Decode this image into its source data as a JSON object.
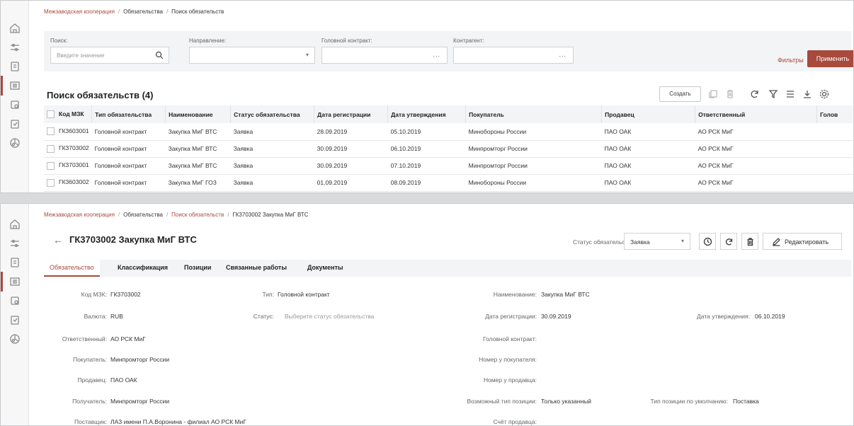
{
  "breadcrumbs1": [
    "Межзаводская кооперация",
    "Обязательства",
    "Поиск обязательств"
  ],
  "breadcrumbs2": [
    "Межзаводская кооперация",
    "Обязательства",
    "Поиск обязательств",
    "ГК3703002 Закупка МиГ ВТС"
  ],
  "filters": {
    "search_label": "Поиск:",
    "search_placeholder": "Введите значение",
    "direction_label": "Направление:",
    "head_contract_label": "Головной контракт:",
    "counterparty_label": "Контрагент:",
    "dots": "...",
    "filters_link": "Фильтры",
    "apply_label": "Применить"
  },
  "list": {
    "title": "Поиск обязательств (4)",
    "create_label": "Создать",
    "columns": [
      "Код МЗК",
      "Тип обязательства",
      "Наименование",
      "Статус обязательства",
      "Дата регистрации",
      "Дата утверждения",
      "Покупатель",
      "Продавец",
      "Ответственный",
      "Голов"
    ],
    "rows": [
      [
        "ГК3603001",
        "Головной контракт",
        "Закупка МиГ ВТС",
        "Заявка",
        "28.09.2019",
        "05.10.2019",
        "Минобороны России",
        "ПАО ОАК",
        "АО РСК МиГ",
        ""
      ],
      [
        "ГК3703002",
        "Головной контракт",
        "Закупка МиГ ВТС",
        "Заявка",
        "30.09.2019",
        "06.10.2019",
        "Минпромторг России",
        "ПАО ОАК",
        "АО РСК МиГ",
        ""
      ],
      [
        "ГК3703001",
        "Головной контракт",
        "Закупка МиГ ВТС",
        "Заявка",
        "30.09.2019",
        "07.10.2019",
        "Минпромторг России",
        "ПАО ОАК",
        "АО РСК МиГ",
        ""
      ],
      [
        "ГК3603002",
        "Головной контракт",
        "Закупка МиГ ГОЗ",
        "Заявка",
        "01.09.2019",
        "08.09.2019",
        "Минобороны России",
        "ПАО ОАК",
        "АО РСК МиГ",
        ""
      ]
    ]
  },
  "detail": {
    "title": "ГК3703002 Закупка МиГ ВТС",
    "status_label": "Статус обязательства",
    "status_value": "Заявка",
    "edit_label": "Редактировать",
    "tabs": [
      "Обязательство",
      "Классификация",
      "Позиции",
      "Связанные работы",
      "Документы"
    ],
    "fields": {
      "code_k": "Код МЗК:",
      "code_v": "ГК3703002",
      "type_k": "Тип:",
      "type_v": "Головной контракт",
      "name_k": "Наименование:",
      "name_v": "Закупка МиГ ВТС",
      "currency_k": "Валюта:",
      "currency_v": "RUB",
      "status_k": "Статус:",
      "status_v": "Выберите статус обязательства",
      "reg_k": "Дата регистрации:",
      "reg_v": "30.09.2019",
      "appr_k": "Дата утверждения:",
      "appr_v": "06.10.2019",
      "resp_k": "Ответственный:",
      "resp_v": "АО РСК МиГ",
      "headc_k": "Головной контракт:",
      "buyer_k": "Покупатель:",
      "buyer_v": "Минпромторг России",
      "buyer_no_k": "Номер у покупателя:",
      "seller_k": "Продавец:",
      "seller_v": "ПАО ОАК",
      "seller_no_k": "Номер у продавца:",
      "recv_k": "Получатель:",
      "recv_v": "Минпромторг России",
      "pos_type_k": "Возможный тип позиции:",
      "pos_type_v": "Только указанный",
      "def_pos_k": "Тип позиции по умолчанию:",
      "def_pos_v": "Поставка",
      "supplier_k": "Поставщик:",
      "supplier_v": "ЛАЗ имени П.А.Воронина - филиал АО РСК МиГ",
      "invoice_k": "Счёт продавца:"
    }
  },
  "icons": [
    "home-icon",
    "sliders-icon",
    "document-icon",
    "list-icon",
    "copy-icon",
    "clipboard-icon",
    "chart-icon"
  ],
  "accent": "#a84a3c"
}
